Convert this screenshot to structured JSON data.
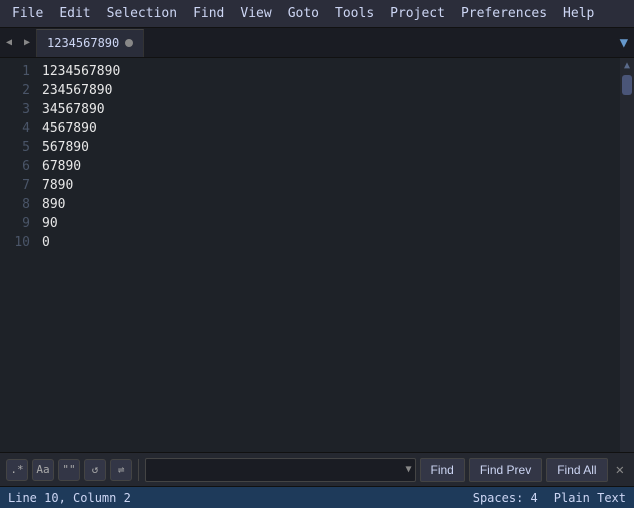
{
  "menu": {
    "items": [
      "File",
      "Edit",
      "Selection",
      "Find",
      "View",
      "Goto",
      "Tools",
      "Project",
      "Preferences",
      "Help"
    ]
  },
  "tab": {
    "label": "1234567890",
    "has_dot": true
  },
  "editor": {
    "lines": [
      {
        "num": 1,
        "code": "1234567890"
      },
      {
        "num": 2,
        "code": "234567890"
      },
      {
        "num": 3,
        "code": "34567890"
      },
      {
        "num": 4,
        "code": "4567890"
      },
      {
        "num": 5,
        "code": "567890"
      },
      {
        "num": 6,
        "code": "67890"
      },
      {
        "num": 7,
        "code": "7890"
      },
      {
        "num": 8,
        "code": "890"
      },
      {
        "num": 9,
        "code": "90"
      },
      {
        "num": 10,
        "code": "0"
      }
    ]
  },
  "find_bar": {
    "regex_label": ".*",
    "case_label": "Aa",
    "word_label": "\"\"",
    "wrap_label": "↺",
    "in_sel_label": "⇌",
    "input_placeholder": "",
    "input_value": "",
    "find_label": "Find",
    "find_prev_label": "Find Prev",
    "find_all_label": "Find All",
    "close_label": "✕"
  },
  "status": {
    "position": "Line 10, Column 2",
    "spaces": "Spaces: 4",
    "type": "Plain Text"
  },
  "colors": {
    "accent": "#6699cc",
    "background": "#1e2228",
    "menu_bg": "#2b2d3a",
    "tab_bg": "#2a2d3a",
    "status_bg": "#1e3a5a"
  }
}
